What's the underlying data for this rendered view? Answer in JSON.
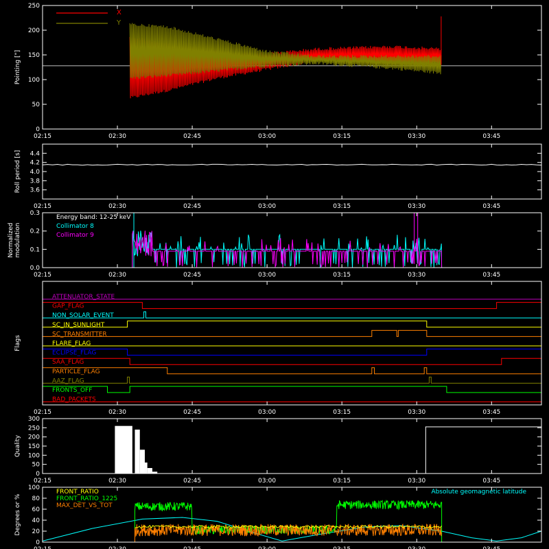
{
  "x_axis": {
    "start_minutes": 0,
    "end_minutes": 100,
    "tick_labels": [
      "02:15",
      "02:30",
      "02:45",
      "03:00",
      "03:15",
      "03:30",
      "03:45"
    ],
    "tick_minutes": [
      0,
      15,
      30,
      45,
      60,
      75,
      90
    ]
  },
  "colors": {
    "background": "#000000",
    "axis": "#ffffff",
    "red": "#ff0000",
    "olive": "#808000",
    "cyan": "#00ffff",
    "magenta": "#ff00ff",
    "green": "#00ff00",
    "yellow": "#ffff00",
    "orange": "#ff8000",
    "blue": "#0000ff",
    "purple": "#c000c0",
    "white": "#ffffff"
  },
  "chart_data": [
    {
      "type": "line",
      "panel": "pointing",
      "ylabel": "Pointing [\"]",
      "ylim": [
        0,
        250
      ],
      "yticks": [
        0,
        50,
        100,
        150,
        200,
        250
      ],
      "legend": [
        "X",
        "Y"
      ],
      "reference_line": 128,
      "series": [
        {
          "name": "X",
          "color": "red",
          "envelope": [
            [
              17.5,
              60,
              190
            ],
            [
              25,
              75,
              175
            ],
            [
              35,
              100,
              160
            ],
            [
              45,
              118,
              155
            ],
            [
              55,
              135,
              165
            ],
            [
              70,
              130,
              170
            ],
            [
              80,
              130,
              165
            ]
          ]
        },
        {
          "name": "Y",
          "color": "olive",
          "envelope": [
            [
              17.5,
              100,
              215
            ],
            [
              25,
              105,
              210
            ],
            [
              35,
              115,
              185
            ],
            [
              45,
              125,
              160
            ],
            [
              55,
              130,
              150
            ],
            [
              70,
              120,
              150
            ],
            [
              80,
              110,
              150
            ]
          ]
        }
      ]
    },
    {
      "type": "line",
      "panel": "roll",
      "ylabel": "Roll period [s]",
      "ylim": [
        3.4,
        4.6
      ],
      "yticks": [
        3.6,
        3.8,
        4.0,
        4.2,
        4.4
      ],
      "series": [
        {
          "name": "",
          "color": "white",
          "x": [
            0,
            100
          ],
          "y": [
            4.15,
            4.15
          ]
        }
      ]
    },
    {
      "type": "line",
      "panel": "modulation",
      "ylabel": "Normalized modulation",
      "ylim": [
        0,
        0.3
      ],
      "yticks": [
        0.0,
        0.1,
        0.2,
        0.3
      ],
      "legend_title": "Energy band: 12-25 keV",
      "series": [
        {
          "name": "Collimator 8",
          "color": "cyan",
          "baseline": 0.1,
          "x_range": [
            18,
            80
          ]
        },
        {
          "name": "Collimator 9",
          "color": "magenta",
          "baseline": 0.09,
          "x_range": [
            18,
            80
          ]
        }
      ]
    },
    {
      "type": "line",
      "panel": "flags",
      "ylabel": "Flags",
      "flags": [
        {
          "label": "ATTENUATOR_STATE",
          "color": "purple",
          "steps": [
            [
              0,
              0
            ]
          ]
        },
        {
          "label": "GAP_FLAG",
          "color": "red",
          "steps": [
            [
              0,
              1
            ],
            [
              20,
              0
            ],
            [
              91,
              1
            ]
          ]
        },
        {
          "label": "NON_SOLAR_EVENT",
          "color": "cyan",
          "steps": [
            [
              0,
              0
            ],
            [
              20.3,
              1
            ],
            [
              20.7,
              0
            ]
          ]
        },
        {
          "label": "SC_IN_SUNLIGHT",
          "color": "yellow",
          "steps": [
            [
              0,
              0
            ],
            [
              17,
              1
            ],
            [
              77,
              0
            ]
          ]
        },
        {
          "label": "SC_TRANSMITTER",
          "color": "orange",
          "steps": [
            [
              0,
              0
            ],
            [
              66,
              1
            ],
            [
              71,
              0
            ],
            [
              71.3,
              1
            ],
            [
              77,
              0
            ]
          ]
        },
        {
          "label": "FLARE_FLAG",
          "color": "yellow",
          "steps": [
            [
              0,
              0
            ]
          ]
        },
        {
          "label": "ECLIPSE_FLAG",
          "color": "blue",
          "steps": [
            [
              0,
              1
            ],
            [
              17,
              0
            ],
            [
              77,
              1
            ]
          ]
        },
        {
          "label": "SAA_FLAG",
          "color": "red",
          "steps": [
            [
              0,
              1
            ],
            [
              17.5,
              0
            ],
            [
              92,
              1
            ]
          ]
        },
        {
          "label": "PARTICLE_FLAG",
          "color": "orange",
          "steps": [
            [
              0,
              1
            ],
            [
              25,
              0
            ],
            [
              66,
              1
            ],
            [
              66.5,
              0
            ],
            [
              76.5,
              1
            ],
            [
              77,
              0
            ]
          ]
        },
        {
          "label": "AAZ_FLAG",
          "color": "olive",
          "steps": [
            [
              0,
              0
            ],
            [
              17,
              1
            ],
            [
              17.4,
              0
            ],
            [
              77.5,
              1
            ],
            [
              77.9,
              0
            ]
          ]
        },
        {
          "label": "FRONTS_OFF",
          "color": "green",
          "steps": [
            [
              0,
              1
            ],
            [
              13,
              0
            ],
            [
              17.5,
              1
            ],
            [
              81,
              0
            ]
          ]
        },
        {
          "label": "BAD_PACKETS",
          "color": "red",
          "steps": [
            [
              0,
              0
            ]
          ]
        }
      ]
    },
    {
      "type": "bar",
      "panel": "quality",
      "ylabel": "Quality",
      "ylim": [
        0,
        300
      ],
      "yticks": [
        0,
        50,
        100,
        150,
        200,
        250,
        300
      ],
      "series": [
        {
          "name": "",
          "color": "white",
          "segments": [
            [
              14.5,
              18,
              260
            ],
            [
              18.5,
              19.5,
              240
            ],
            [
              19.5,
              20.5,
              130
            ],
            [
              20.5,
              21,
              60
            ],
            [
              21,
              22,
              30
            ],
            [
              22,
              23,
              10
            ],
            [
              76.8,
              100,
              255
            ]
          ]
        }
      ]
    },
    {
      "type": "line",
      "panel": "misc",
      "ylabel": "Degrees or %",
      "ylim": [
        0,
        100
      ],
      "yticks": [
        0,
        20,
        40,
        60,
        80,
        100
      ],
      "series": [
        {
          "name": "FRONT_RATIO",
          "color": "yellow",
          "value": 28,
          "x_range": [
            18.5,
            80
          ]
        },
        {
          "name": "FRONT_RATIO_1225",
          "color": "green",
          "segments": [
            [
              18.5,
              30,
              65
            ],
            [
              30,
              59,
              22
            ],
            [
              59,
              80,
              68
            ]
          ]
        },
        {
          "name": "MAX_DET_VS_TOT",
          "color": "orange",
          "value": 22,
          "x_range": [
            18.5,
            80
          ]
        },
        {
          "name": "Absolute geomagnetic latitude",
          "color": "cyan",
          "points": [
            [
              0,
              2
            ],
            [
              10,
              25
            ],
            [
              20,
              42
            ],
            [
              28,
              45
            ],
            [
              35,
              38
            ],
            [
              42,
              18
            ],
            [
              48,
              2
            ],
            [
              56,
              15
            ],
            [
              65,
              28
            ],
            [
              72,
              30
            ],
            [
              80,
              20
            ],
            [
              86,
              8
            ],
            [
              91,
              2
            ],
            [
              96,
              8
            ],
            [
              100,
              20
            ]
          ]
        }
      ]
    }
  ]
}
